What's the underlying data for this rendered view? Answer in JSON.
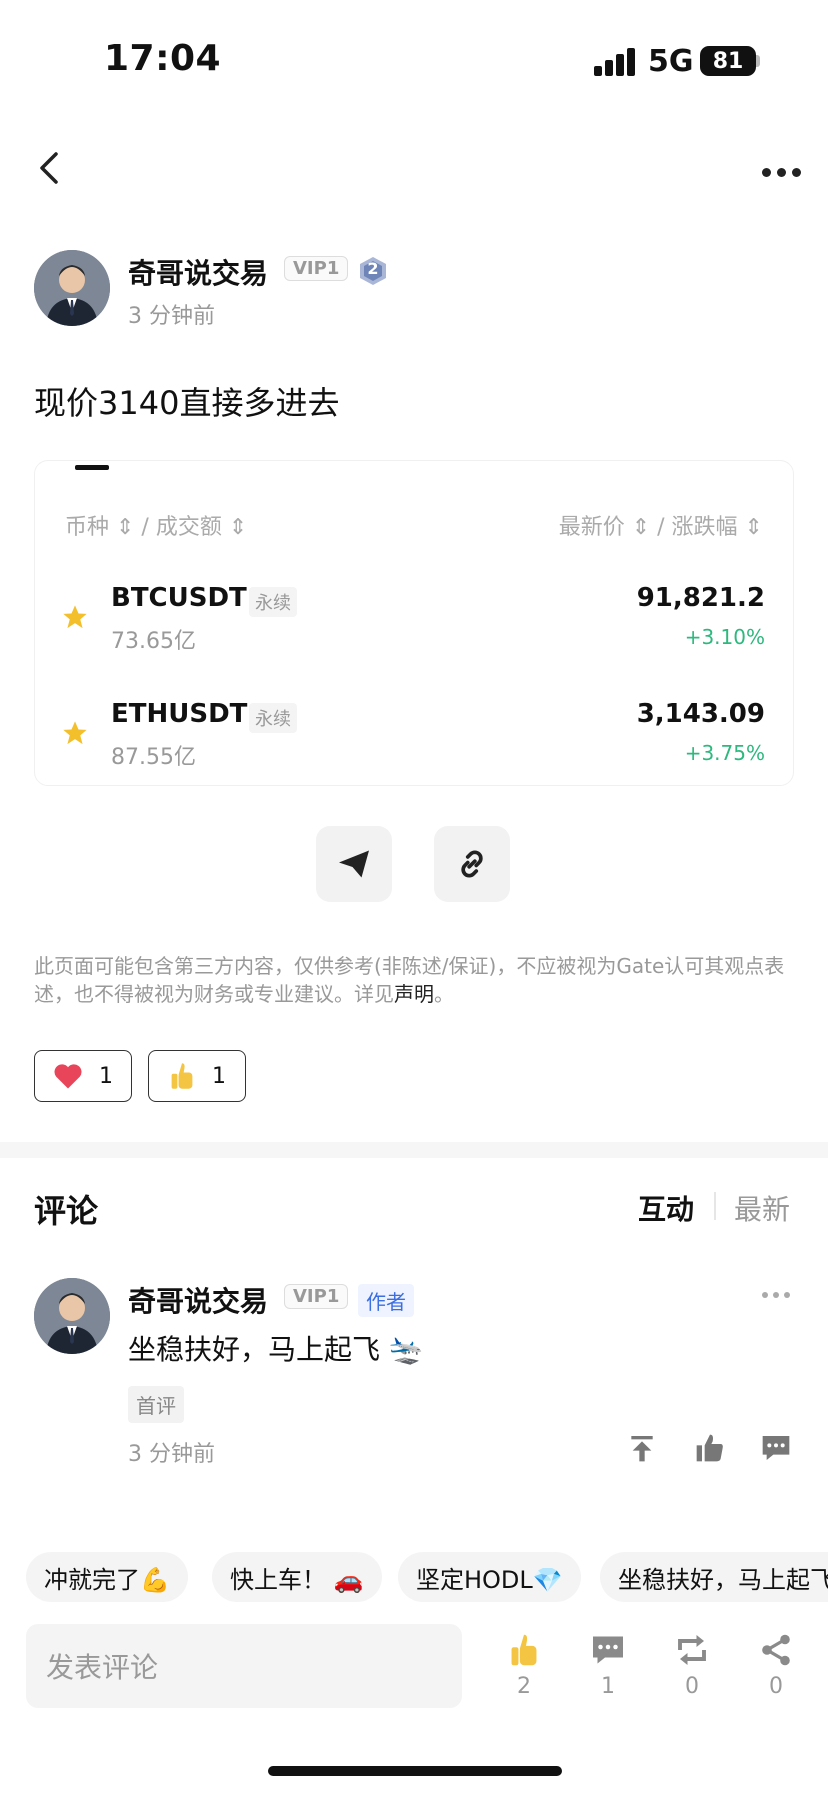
{
  "status": {
    "time": "17:04",
    "network": "5G",
    "battery": "81"
  },
  "post": {
    "author": "奇哥说交易",
    "vip": "VIP1",
    "level": "2",
    "time": "3 分钟前",
    "text": "现价3140直接多进去"
  },
  "market": {
    "head_left": "币种 ⇕ / 成交额 ⇕",
    "head_right": "最新价 ⇕ / 涨跌幅 ⇕",
    "rows": [
      {
        "symbol": "BTCUSDT",
        "tag": "永续",
        "volume": "73.65亿",
        "price": "91,821.2",
        "change": "+3.10%"
      },
      {
        "symbol": "ETHUSDT",
        "tag": "永续",
        "volume": "87.55亿",
        "price": "3,143.09",
        "change": "+3.75%"
      }
    ]
  },
  "disclaimer": {
    "text": "此页面可能包含第三方内容，仅供参考(非陈述/保证)，不应被视为Gate认可其观点表述，也不得被视为财务或专业建议。详见",
    "link": "声明",
    "end": "。"
  },
  "reactions": [
    {
      "icon": "heart-icon",
      "count": "1"
    },
    {
      "icon": "thumbs-up-icon",
      "count": "1"
    }
  ],
  "comments": {
    "title": "评论",
    "sort_active": "互动",
    "sort_other": "最新",
    "items": [
      {
        "author": "奇哥说交易",
        "vip": "VIP1",
        "badge": "作者",
        "text": "坐稳扶好，马上起飞 🛬",
        "tag": "首评",
        "time": "3 分钟前"
      }
    ]
  },
  "quick_replies": [
    "冲就完了💪",
    "快上车！ 🚗",
    "坚定HODL💎",
    "坐稳扶好，马上起飞"
  ],
  "bottom_bar": {
    "placeholder": "发表评论",
    "likes": "2",
    "comments": "1",
    "reposts": "0",
    "shares": "0"
  },
  "colors": {
    "up": "#2eb87e",
    "star": "#f3c02c",
    "heart": "#e8445a",
    "author_tag": "#3b6ee0"
  }
}
